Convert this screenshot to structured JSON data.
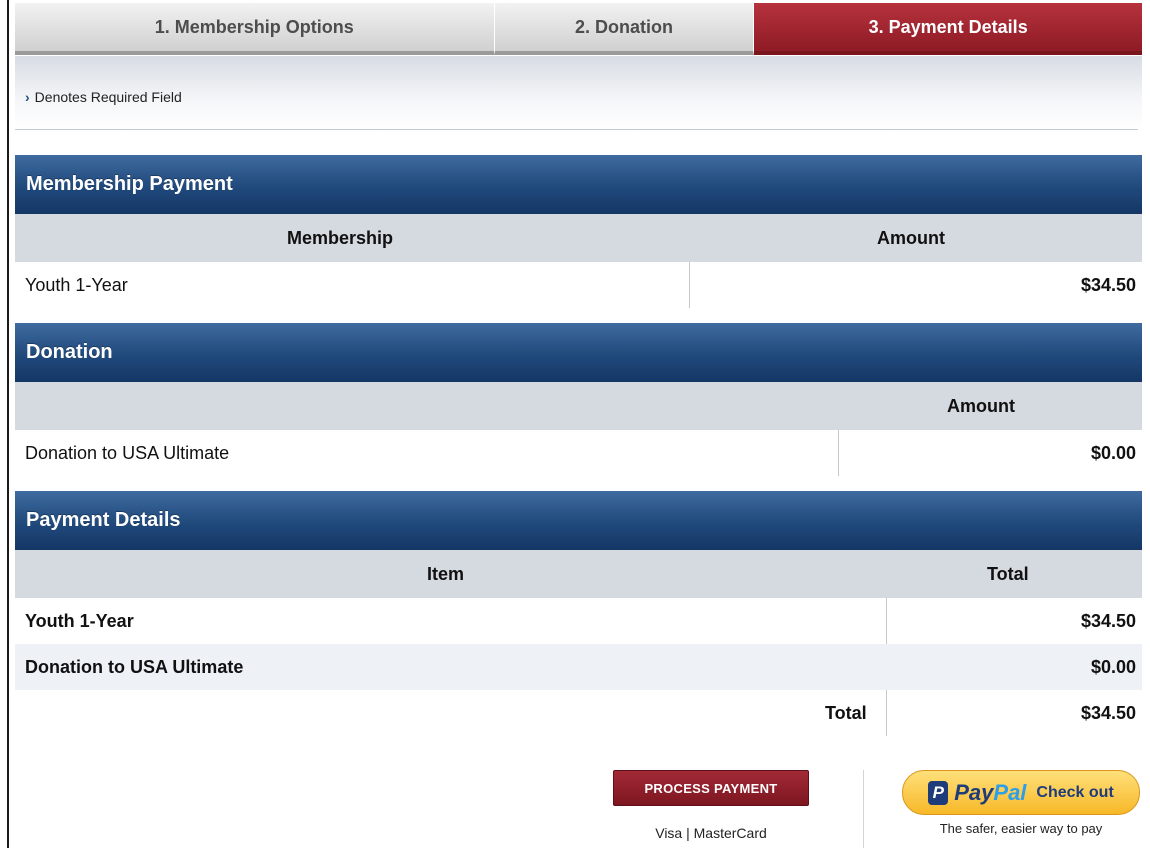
{
  "steps": [
    {
      "label": "1. Membership Options",
      "active": false
    },
    {
      "label": "2. Donation",
      "active": false
    },
    {
      "label": "3. Payment Details",
      "active": true
    }
  ],
  "required_note": "Denotes Required Field",
  "membership": {
    "title": "Membership Payment",
    "columns": [
      "Membership",
      "Amount"
    ],
    "rows": [
      {
        "name": "Youth 1-Year",
        "amount": "$34.50"
      }
    ]
  },
  "donation": {
    "title": "Donation",
    "columns": [
      "",
      "Amount"
    ],
    "rows": [
      {
        "name": "Donation to USA Ultimate",
        "amount": "$0.00"
      }
    ]
  },
  "payment": {
    "title": "Payment Details",
    "columns": [
      "Item",
      "Total"
    ],
    "rows": [
      {
        "name": "Youth 1-Year",
        "total": "$34.50"
      },
      {
        "name": "Donation to USA Ultimate",
        "total": "$0.00"
      }
    ],
    "total_label": "Total",
    "total_value": "$34.50"
  },
  "actions": {
    "process_label": "PROCESS PAYMENT",
    "cards": "Visa | MasterCard",
    "paypal_pay": "Pay",
    "paypal_pal": "Pal",
    "paypal_checkout": "Check out",
    "paypal_tagline": "The safer, easier way to pay"
  },
  "colors": {
    "active_tab": "#9b2430",
    "section_header": "#20497c",
    "process_button": "#8e1b25",
    "paypal_yellow": "#f9c33c"
  }
}
